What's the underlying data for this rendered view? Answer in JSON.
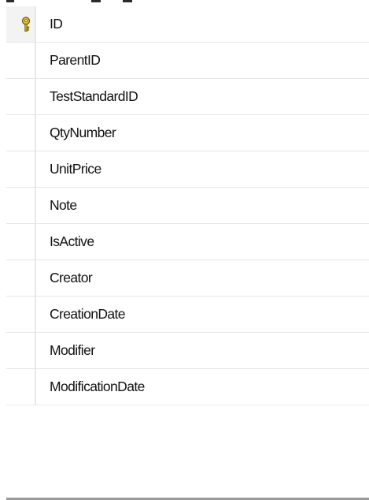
{
  "columns": [
    {
      "name": "ID",
      "primary_key": true
    },
    {
      "name": "ParentID",
      "primary_key": false
    },
    {
      "name": "TestStandardID",
      "primary_key": false
    },
    {
      "name": "QtyNumber",
      "primary_key": false
    },
    {
      "name": "UnitPrice",
      "primary_key": false
    },
    {
      "name": "Note",
      "primary_key": false
    },
    {
      "name": "IsActive",
      "primary_key": false
    },
    {
      "name": "Creator",
      "primary_key": false
    },
    {
      "name": "CreationDate",
      "primary_key": false
    },
    {
      "name": "Modifier",
      "primary_key": false
    },
    {
      "name": "ModificationDate",
      "primary_key": false
    }
  ],
  "icons": {
    "primary_key": "primary-key-icon"
  },
  "colors": {
    "key_gold": "#e3c21a",
    "key_outline": "#6b5a12"
  }
}
